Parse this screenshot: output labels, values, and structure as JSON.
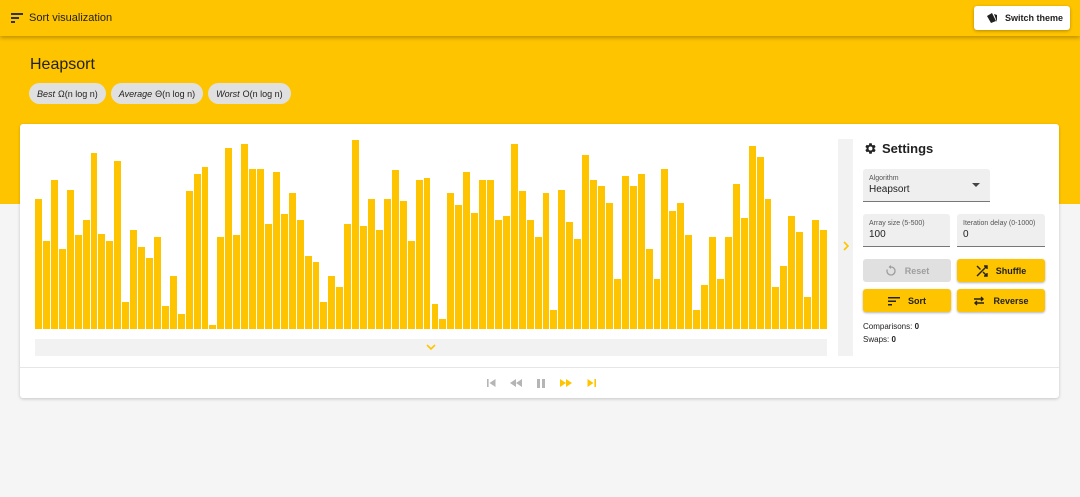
{
  "app": {
    "title": "Sort visualization",
    "theme_button": "Switch theme"
  },
  "page": {
    "title": "Heapsort"
  },
  "complexity": [
    {
      "case": "Best",
      "value": "Ω(n log n)"
    },
    {
      "case": "Average",
      "value": "Θ(n log n)"
    },
    {
      "case": "Worst",
      "value": "O(n log n)"
    }
  ],
  "settings": {
    "title": "Settings",
    "algorithm": {
      "label": "Algorithm",
      "value": "Heapsort"
    },
    "array_size": {
      "label": "Array size (5-500)",
      "value": "100"
    },
    "delay": {
      "label": "Iteration delay (0-1000)",
      "value": "0"
    },
    "buttons": {
      "reset": "Reset",
      "shuffle": "Shuffle",
      "sort": "Sort",
      "reverse": "Reverse"
    }
  },
  "stats": {
    "comparisons_label": "Comparisons:",
    "comparisons": "0",
    "swaps_label": "Swaps:",
    "swaps": "0"
  },
  "colors": {
    "accent": "#ffc400",
    "background": "#f5f5f5"
  },
  "array": [
    68,
    46,
    78,
    42,
    73,
    49,
    57,
    92,
    50,
    46,
    88,
    14,
    52,
    43,
    37,
    48,
    12,
    28,
    8,
    72,
    81,
    85,
    2,
    48,
    95,
    49,
    97,
    84,
    84,
    55,
    82,
    60,
    71,
    57,
    38,
    35,
    14,
    28,
    22,
    55,
    99,
    54,
    68,
    52,
    68,
    83,
    67,
    46,
    78,
    79,
    13,
    5,
    71,
    65,
    82,
    61,
    78,
    78,
    57,
    59,
    97,
    72,
    57,
    48,
    71,
    10,
    73,
    56,
    47,
    91,
    78,
    75,
    66,
    26,
    80,
    75,
    81,
    42,
    26,
    84,
    62,
    66,
    49,
    10,
    23,
    48,
    26,
    48,
    76,
    58,
    96,
    90,
    68,
    22,
    33,
    59,
    51,
    17,
    57,
    52
  ]
}
